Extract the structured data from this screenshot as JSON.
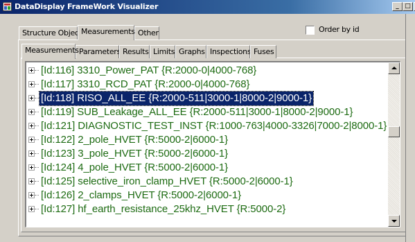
{
  "window": {
    "title": "DataDisplay FrameWork Visualizer",
    "minimize_glyph": "_",
    "maximize_glyph": "□",
    "close_glyph": "×"
  },
  "outer_tabs": [
    {
      "label": "Structure Objects",
      "selected": false
    },
    {
      "label": "Measurements",
      "selected": true
    },
    {
      "label": "Other",
      "selected": false
    }
  ],
  "order_by_id": {
    "label": "Order by id",
    "checked": false
  },
  "inner_tabs": [
    {
      "label": "Measurements",
      "selected": true
    },
    {
      "label": "Parameters",
      "selected": false
    },
    {
      "label": "Results",
      "selected": false
    },
    {
      "label": "Limits",
      "selected": false
    },
    {
      "label": "Graphs",
      "selected": false
    },
    {
      "label": "Inspections",
      "selected": false
    },
    {
      "label": "Fuses",
      "selected": false
    }
  ],
  "tree_items": [
    {
      "text": "[Id:116] 3310_Power_PAT {R:2000-0|4000-768}",
      "selected": false
    },
    {
      "text": "[Id:117] 3310_RCD_PAT {R:2000-0|4000-768}",
      "selected": false
    },
    {
      "text": "[Id:118] RISO_ALL_EE {R:2000-511|3000-1|8000-2|9000-1}",
      "selected": true
    },
    {
      "text": "[Id:119] SUB_Leakage_ALL_EE {R:2000-511|3000-1|8000-2|9000-1}",
      "selected": false
    },
    {
      "text": "[Id:121] DIAGNOSTIC_TEST_INST {R:1000-763|4000-3326|7000-2|8000-1}",
      "selected": false
    },
    {
      "text": "[Id:122] 2_pole_HVET {R:5000-2|6000-1}",
      "selected": false
    },
    {
      "text": "[Id:123] 3_pole_HVET {R:5000-2|6000-1}",
      "selected": false
    },
    {
      "text": "[Id:124] 4_pole_HVET {R:5000-2|6000-1}",
      "selected": false
    },
    {
      "text": "[Id:125] selective_iron_clamp_HVET {R:5000-2|6000-1}",
      "selected": false
    },
    {
      "text": "[Id:126] 2_clamps_HVET {R:5000-2|6000-1}",
      "selected": false
    },
    {
      "text": "[Id:127] hf_earth_resistance_25khz_HVET {R:5000-2}",
      "selected": false
    }
  ],
  "colors": {
    "item_text": "#1d6b12",
    "selection_bg": "#0a246a",
    "title_bar": "#0a246a"
  }
}
